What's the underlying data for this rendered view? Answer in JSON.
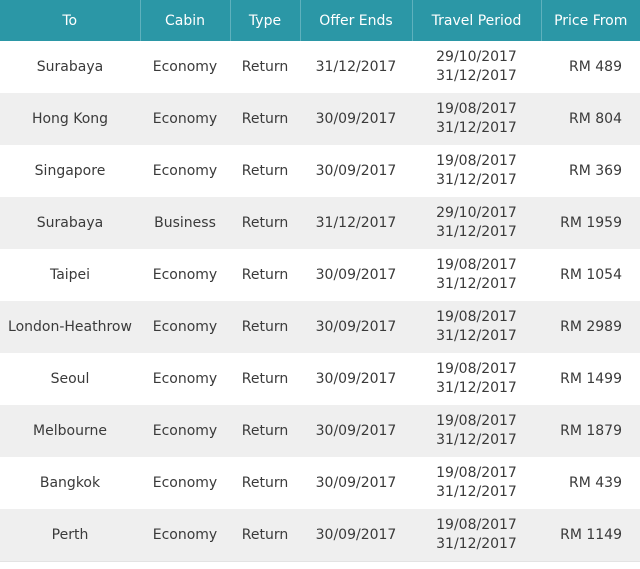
{
  "table": {
    "headers": {
      "to": "To",
      "cabin": "Cabin",
      "type": "Type",
      "offer_ends": "Offer Ends",
      "travel_period": "Travel Period",
      "price_from": "Price From"
    },
    "rows": [
      {
        "to": "Surabaya",
        "cabin": "Economy",
        "type": "Return",
        "offer_ends": "31/12/2017",
        "travel_start": "29/10/2017",
        "travel_end": "31/12/2017",
        "price": "RM 489"
      },
      {
        "to": "Hong Kong",
        "cabin": "Economy",
        "type": "Return",
        "offer_ends": "30/09/2017",
        "travel_start": "19/08/2017",
        "travel_end": "31/12/2017",
        "price": "RM 804"
      },
      {
        "to": "Singapore",
        "cabin": "Economy",
        "type": "Return",
        "offer_ends": "30/09/2017",
        "travel_start": "19/08/2017",
        "travel_end": "31/12/2017",
        "price": "RM 369"
      },
      {
        "to": "Surabaya",
        "cabin": "Business",
        "type": "Return",
        "offer_ends": "31/12/2017",
        "travel_start": "29/10/2017",
        "travel_end": "31/12/2017",
        "price": "RM 1959"
      },
      {
        "to": "Taipei",
        "cabin": "Economy",
        "type": "Return",
        "offer_ends": "30/09/2017",
        "travel_start": "19/08/2017",
        "travel_end": "31/12/2017",
        "price": "RM 1054"
      },
      {
        "to": "London-Heathrow",
        "cabin": "Economy",
        "type": "Return",
        "offer_ends": "30/09/2017",
        "travel_start": "19/08/2017",
        "travel_end": "31/12/2017",
        "price": "RM 2989"
      },
      {
        "to": "Seoul",
        "cabin": "Economy",
        "type": "Return",
        "offer_ends": "30/09/2017",
        "travel_start": "19/08/2017",
        "travel_end": "31/12/2017",
        "price": "RM 1499"
      },
      {
        "to": "Melbourne",
        "cabin": "Economy",
        "type": "Return",
        "offer_ends": "30/09/2017",
        "travel_start": "19/08/2017",
        "travel_end": "31/12/2017",
        "price": "RM 1879"
      },
      {
        "to": "Bangkok",
        "cabin": "Economy",
        "type": "Return",
        "offer_ends": "30/09/2017",
        "travel_start": "19/08/2017",
        "travel_end": "31/12/2017",
        "price": "RM 439"
      },
      {
        "to": "Perth",
        "cabin": "Economy",
        "type": "Return",
        "offer_ends": "30/09/2017",
        "travel_start": "19/08/2017",
        "travel_end": "31/12/2017",
        "price": "RM 1149"
      }
    ]
  },
  "colors": {
    "header_bg": "#2b97a6",
    "header_text": "#ffffff",
    "row_alt_bg": "#efefef",
    "text": "#3a3a3a"
  }
}
